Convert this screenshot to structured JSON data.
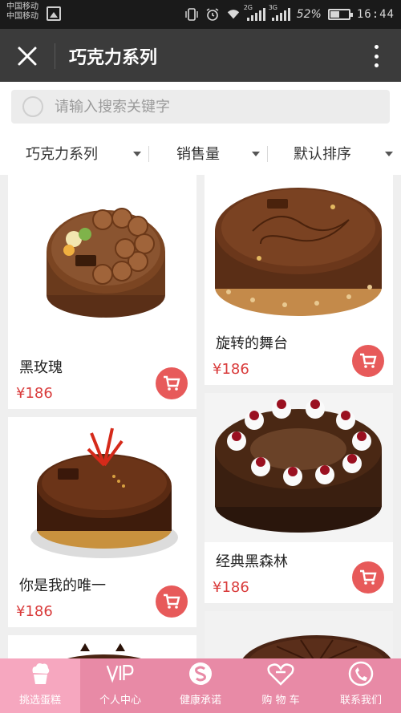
{
  "status_bar": {
    "carrier_1": "中国移动",
    "carrier_2": "中国移动",
    "network_1": "2G",
    "network_2": "3G",
    "battery_percent": "52%",
    "battery_level": 0.52,
    "time": "16:44"
  },
  "app_bar": {
    "title": "巧克力系列"
  },
  "search": {
    "placeholder": "请输入搜索关键字"
  },
  "filters": [
    {
      "label": "巧克力系列"
    },
    {
      "label": "销售量"
    },
    {
      "label": "默认排序"
    }
  ],
  "products": [
    {
      "name": "黑玫瑰",
      "price": "¥186"
    },
    {
      "name": "旋转的舞台",
      "price": "¥186"
    },
    {
      "name": "你是我的唯一",
      "price": "¥186"
    },
    {
      "name": "经典黑森林",
      "price": "¥186"
    }
  ],
  "tab_bar": {
    "active_index": 0,
    "items": [
      {
        "label": "挑选蛋糕"
      },
      {
        "label": "个人中心"
      },
      {
        "label": "健康承诺"
      },
      {
        "label": "购 物 车"
      },
      {
        "label": "联系我们"
      }
    ]
  },
  "colors": {
    "status_bg": "#1a1a1a",
    "app_bar_bg": "#3b3b3b",
    "price": "#d93b3b",
    "cart_button": "#e75a5a",
    "tab_bar": "#e88aa6",
    "tab_active": "#f6a7bf"
  }
}
